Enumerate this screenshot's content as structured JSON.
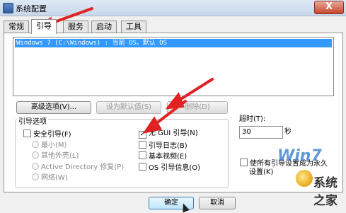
{
  "window": {
    "title": "系统配置",
    "close_glyph": "X"
  },
  "tabs": [
    "常规",
    "引导",
    "服务",
    "启动",
    "工具"
  ],
  "os_list": [
    "Windows 7 (C:\\Windows) : 当前 OS。默认 OS"
  ],
  "buttons": {
    "advanced": "高级选项(V)...",
    "set_default": "设为默认值(S)",
    "delete": "删除(D)",
    "ok": "确定",
    "cancel": "取消"
  },
  "boot_options": {
    "group_label": "引导选项",
    "safe_boot": "安全引导(F)",
    "minimal": "最小(M)",
    "alternate_shell": "其他外壳(L)",
    "ad_repair": "Active Directory 修复(P)",
    "network": "网络(W)",
    "no_gui": "无 GUI 引导(N)",
    "no_gui_checked": true,
    "boot_log": "引导日志(B)",
    "base_video": "基本视频(E)",
    "os_boot_info": "OS 引导信息(O)"
  },
  "timeout": {
    "label": "超时(T):",
    "value": "30",
    "unit": "秒"
  },
  "permanent": {
    "label_line1": "使所有引导设置成为永久",
    "label_line2": "设置(K)"
  },
  "watermark": {
    "win_text": "Win7",
    "site_text": "系统之家"
  }
}
